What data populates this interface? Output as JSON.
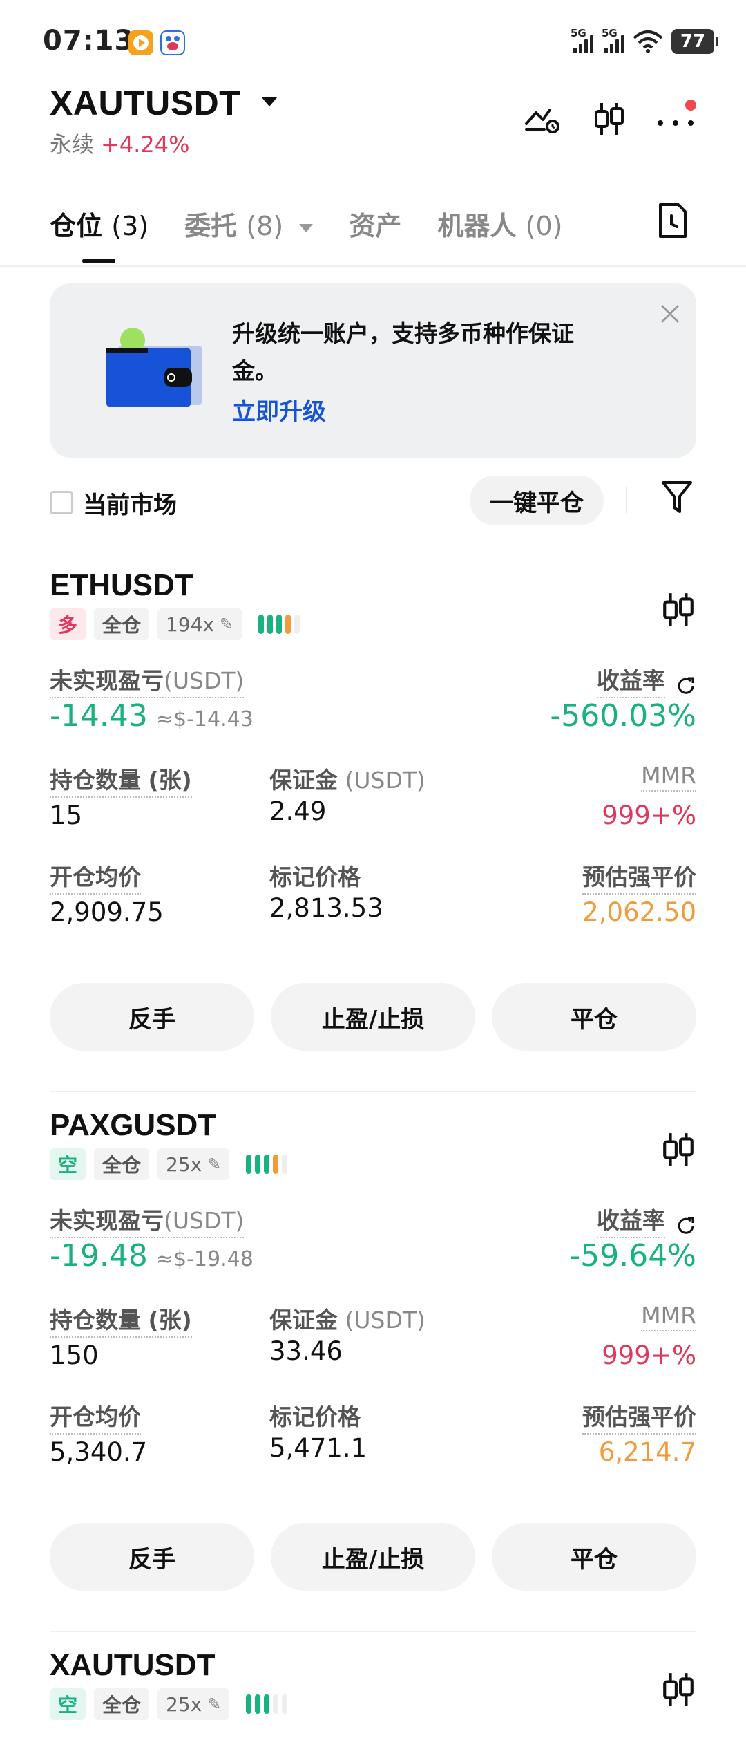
{
  "status_bar": {
    "time": "07:13",
    "signal_1": "5G",
    "signal_2": "5G",
    "battery": "77"
  },
  "header": {
    "symbol": "XAUTUSDT",
    "type": "永续",
    "change": "+4.24%"
  },
  "tabs": [
    {
      "label": "仓位",
      "count": "(3)"
    },
    {
      "label": "委托",
      "count": "(8)"
    },
    {
      "label": "资产",
      "count": ""
    },
    {
      "label": "机器人",
      "count": "(0)"
    }
  ],
  "banner": {
    "text": "升级统一账户，支持多币种作保证金。",
    "link": "立即升级"
  },
  "filter": {
    "current_market": "当前市场",
    "close_all": "一键平仓"
  },
  "labels": {
    "unrealized_pnl": "未实现盈亏",
    "unit_usdt": "(USDT)",
    "ror": "收益率",
    "position_qty": "持仓数量",
    "qty_unit": "(张)",
    "margin": "保证金",
    "mmr": "MMR",
    "entry_price": "开仓均价",
    "mark_price": "标记价格",
    "liq_price": "预估强平价",
    "reverse": "反手",
    "tpsl": "止盈/止损",
    "close": "平仓",
    "margin_mode": "全仓"
  },
  "positions": [
    {
      "symbol": "ETHUSDT",
      "side": "多",
      "side_type": "long",
      "leverage": "194x",
      "pnl": "-14.43",
      "pnl_usd": "≈$-14.43",
      "ror": "-560.03%",
      "qty": "15",
      "margin": "2.49",
      "mmr": "999+%",
      "entry": "2,909.75",
      "mark": "2,813.53",
      "liq": "2,062.50"
    },
    {
      "symbol": "PAXGUSDT",
      "side": "空",
      "side_type": "short",
      "leverage": "25x",
      "pnl": "-19.48",
      "pnl_usd": "≈$-19.48",
      "ror": "-59.64%",
      "qty": "150",
      "margin": "33.46",
      "mmr": "999+%",
      "entry": "5,340.7",
      "mark": "5,471.1",
      "liq": "6,214.7"
    },
    {
      "symbol": "XAUTUSDT",
      "side": "空",
      "side_type": "short",
      "leverage": "25x"
    }
  ],
  "colors": {
    "up_red": "#e0385c",
    "down_green": "#17b27f",
    "warn_orange": "#f39a3c",
    "link_blue": "#1653d9"
  }
}
